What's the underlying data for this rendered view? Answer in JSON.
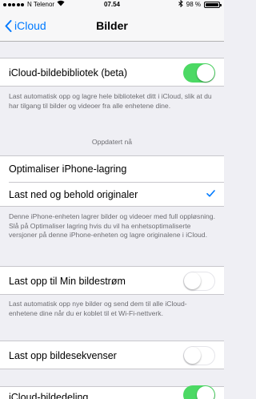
{
  "status_bar": {
    "carrier": "N Telenor",
    "time": "07.54",
    "battery": "98 %",
    "battery_level": 0.98
  },
  "nav": {
    "back_label": "iCloud",
    "title": "Bilder"
  },
  "library": {
    "label": "iCloud-bildebibliotek (beta)",
    "enabled": true,
    "footer": "Last automatisk opp og lagre hele biblioteket ditt i iCloud, slik at du har tilgang til bilder og videoer fra alle enhetene dine.",
    "status": "Oppdatert nå"
  },
  "storage": {
    "option_optimize": "Optimaliser iPhone-lagring",
    "option_keep": "Last ned og behold originaler",
    "selected": "Last ned og behold originaler",
    "footer": "Denne iPhone-enheten lagrer bilder og videoer med full oppløsning. Slå på Optimaliser lagring hvis du vil ha enhetsoptimaliserte versjoner på denne iPhone-enheten og lagre originalene i iCloud."
  },
  "photostream": {
    "label": "Last opp til Min bildestrøm",
    "enabled": false,
    "footer": "Last automatisk opp nye bilder og send dem til alle iCloud-enhetene dine når du er koblet til et Wi-Fi-nettverk."
  },
  "burst": {
    "label": "Last opp bildesekvenser",
    "enabled": false
  },
  "sharing": {
    "label": "iCloud-bildedeling",
    "enabled": true
  },
  "colors": {
    "accent": "#007aff",
    "toggle_on": "#4cd964",
    "background": "#efeff4"
  }
}
